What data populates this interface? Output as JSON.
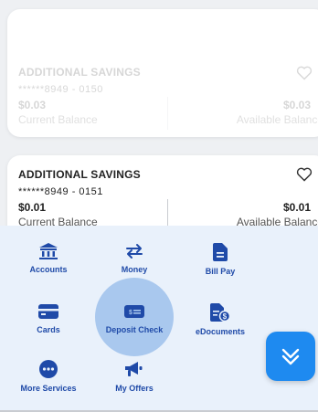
{
  "accounts": [
    {
      "name": "ADDITIONAL SAVINGS",
      "number": "******8949 - 0150",
      "current_balance": "$0.03",
      "current_label": "Current Balance",
      "available_balance": "$0.03",
      "available_label": "Available Balance"
    },
    {
      "name": "ADDITIONAL SAVINGS",
      "number": "******8949 - 0151",
      "current_balance": "$0.01",
      "current_label": "Current Balance",
      "available_balance": "$0.01",
      "available_label": "Available Balance"
    }
  ],
  "menu": {
    "items": [
      {
        "label": "Accounts",
        "icon": "bank-icon"
      },
      {
        "label": "Money",
        "icon": "transfer-arrows-icon"
      },
      {
        "label": "Bill Pay",
        "icon": "bill-icon"
      },
      {
        "label": "Cards",
        "icon": "card-icon"
      },
      {
        "label": "Deposit Check",
        "icon": "check-icon"
      },
      {
        "label": "eDocuments",
        "icon": "document-dollar-icon"
      },
      {
        "label": "More Services",
        "icon": "more-icon"
      },
      {
        "label": "My Offers",
        "icon": "megaphone-icon"
      }
    ]
  },
  "colors": {
    "primary": "#1f4aa8",
    "menu_background": "#e9f1fb",
    "highlight": "#a9c8ee",
    "fab": "#1e8af0"
  }
}
